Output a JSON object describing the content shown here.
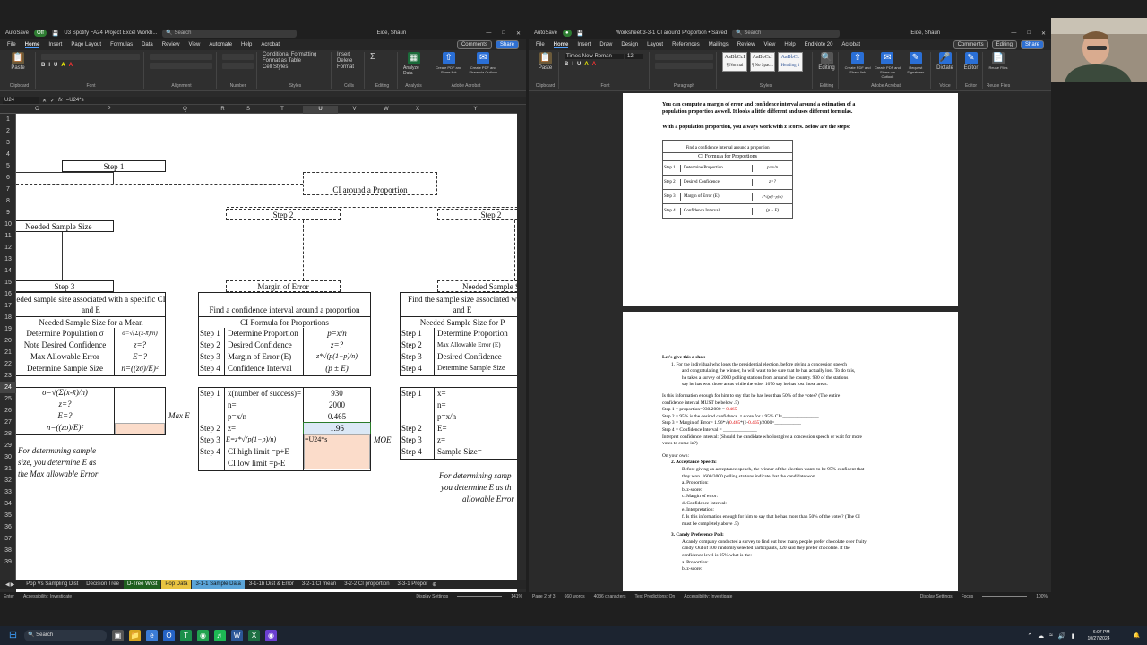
{
  "excel": {
    "autosave": "AutoSave",
    "toggle": "Off",
    "title": "U3 Spotify FA24 Project Excel Workb...",
    "search": "Search",
    "user": "Eide, Shaun",
    "menu": [
      "File",
      "Home",
      "Insert",
      "Page Layout",
      "Formulas",
      "Data",
      "Review",
      "View",
      "Automate",
      "Help",
      "Acrobat"
    ],
    "comments": "Comments",
    "share": "Share",
    "groups": [
      "Clipboard",
      "Font",
      "Alignment",
      "Number",
      "Styles",
      "Cells",
      "Editing",
      "Analysis",
      "Adobe Acrobat"
    ],
    "ribbon": {
      "paste": "Paste",
      "cond_format": "Conditional Formatting",
      "format_table": "Format as Table",
      "cell_styles": "Cell Styles",
      "insert": "Insert",
      "delete": "Delete",
      "format": "Format",
      "analyze": "Analyze Data",
      "pdf1": "Create PDF and Share link",
      "pdf2": "Create PDF and Share via Outlook"
    },
    "namebox": "U24",
    "formula": "=U24*s",
    "cols": [
      "O",
      "P",
      "Q",
      "R",
      "S",
      "T",
      "U",
      "V",
      "W",
      "X",
      "Y"
    ],
    "rows": [
      "1",
      "2",
      "3",
      "4",
      "5",
      "6",
      "7",
      "8",
      "9",
      "10",
      "11",
      "12",
      "13",
      "14",
      "15",
      "16",
      "17",
      "18",
      "19",
      "20",
      "21",
      "22",
      "23",
      "24",
      "25",
      "26",
      "27",
      "28",
      "29",
      "30",
      "31",
      "32",
      "33",
      "34",
      "35",
      "36",
      "37",
      "38",
      "39"
    ],
    "cells": {
      "step1": "Step 1",
      "ci_prop": "CI around a Proportion",
      "step2a": "Step 2",
      "step2b": "Step 2",
      "needed_size": "Needed Sample Size",
      "step3": "Step 3",
      "moe": "Margin of Error",
      "needed_size2": "Needed Sample S",
      "l_h13": "eded sample size associated with a specific CI",
      "l_h14": "and E",
      "l_h15": "Needed Sample Size for a Mean",
      "l16a": "Determine Population σ",
      "l16b": "σ=√(Σ(x-x̄)/n)",
      "l17a": "Note Desired Confidence",
      "l17b": "z=?",
      "l18a": "Max Allowable Error",
      "l18b": "E=?",
      "l19a": "Determine Sample Size",
      "l19b": "n=((zσ)/E)²",
      "l21": "σ=√(Σ(x-x̄)/n)",
      "l22": "z=?",
      "l23": "E=?",
      "l23r": "Max E",
      "l24": "n=((zσ)/E)²",
      "l26": "For determining sample",
      "l27": "size, you determine E as",
      "l28": "the Max allowable Error",
      "m_h13": "Find a confidence interval around a proportion",
      "m_h15": "CI Formula for Proportions",
      "m16a": "Step 1",
      "m16b": "Determine Proportion",
      "m16c": "p=x/n",
      "m17a": "Step 2",
      "m17b": "Desired Confidence",
      "m17c": "z=?",
      "m18a": "Step 3",
      "m18b": "Margin of Error (E)",
      "m18c": "z*√(p(1−p)/n)",
      "m19a": "Step 4",
      "m19b": "Confidence Interval",
      "m19c": "(p ± E)",
      "m21a": "Step 1",
      "m21b": "x(number of success)=",
      "m21c": "930",
      "m22b": "n=",
      "m22c": "2000",
      "m23b": "p=x/n",
      "m23c": "0.465",
      "m24a": "Step 2",
      "m24b": "z=",
      "m24c": "1.96",
      "m25a": "Step 3",
      "m25b": "E=z*√(p(1−p)/n)",
      "m25c": "=U24*s",
      "m25r": "MOE",
      "m26a": "Step 4",
      "m26b": "CI high limit =p+E",
      "m27b": "CI low limit =p-E",
      "r_h13": "Find the sample size associated w",
      "r_h14": "and E",
      "r_h15": "Needed Sample Size for P",
      "r16a": "Step 1",
      "r16b": "Determine Proportion",
      "r17a": "Step 2",
      "r17b": "Max Allowable Error (E)",
      "r18a": "Step 3",
      "r18b": "Desired Confidence",
      "r19a": "Step 4",
      "r19b": "Determine Sample Size",
      "r21a": "Step 1",
      "r21b": "x=",
      "r22b": "n=",
      "r23b": "p=x/n",
      "r24a": "Step 2",
      "r24b": "E=",
      "r25a": "Step 3",
      "r25b": "z=",
      "r26a": "Step 4",
      "r26b": "Sample Size=",
      "r27": "For determining samp",
      "r28": "you determine E as th",
      "r29": "allowable Error"
    },
    "tabs": [
      "Pop Vs Sampling Dist",
      "Decision Tree",
      "D-Tree Wkst",
      "Pop Data",
      "3-1-1 Sample Data",
      "3-1-1b Dist & Error",
      "3-2-1 CI mean",
      "3-2-2 CI proportion",
      "3-3-1 Propor"
    ],
    "status": [
      "Enter",
      "Accessibility: Investigate",
      "Display Settings",
      "141%"
    ]
  },
  "word": {
    "autosave": "AutoSave",
    "title": "Worksheet 3-3-1 CI around Proportion • Saved",
    "search": "Search",
    "user": "Eide, Shaun",
    "menu": [
      "File",
      "Home",
      "Insert",
      "Draw",
      "Design",
      "Layout",
      "References",
      "Mailings",
      "Review",
      "View",
      "Help",
      "EndNote 20",
      "Acrobat"
    ],
    "comments": "Comments",
    "editing": "Editing",
    "share": "Share",
    "font": "Times New Roman",
    "size": "12",
    "styles": [
      "AaBbCcI",
      "AaBbCcI",
      "AaBbCc"
    ],
    "style_names": [
      "¶ Normal",
      "¶ No Spac...",
      "Heading 1"
    ],
    "groups": [
      "Clipboard",
      "Font",
      "Paragraph",
      "Styles",
      "Editing",
      "Adobe Acrobat",
      "Voice",
      "Editor",
      "Reuse Files"
    ],
    "ribbon": {
      "paste": "Paste",
      "editing": "Editing",
      "pdf1": "Create PDF and Share link",
      "pdf2": "Create PDF and Share via Outlook",
      "sig": "Request Signatures",
      "dictate": "Dictate",
      "editor": "Editor",
      "reuse": "Reuse Files"
    },
    "p1_line1": "You can compute a margin of error and confidence interval around a estimation of a",
    "p1_line2": "population proportion as well. It looks a little different and uses different formulas.",
    "p1_line3": "With a population proportion, you always work with z scores. Below are the steps:",
    "tbl": {
      "title": "Find a confidence interval around a proportion",
      "sub": "CI Formula for Proportions",
      "rows": [
        [
          "Step 1",
          "Determine Proportion",
          "p=x/n"
        ],
        [
          "Step 2",
          "Desired Confidence",
          "z=?"
        ],
        [
          "Step 3",
          "Margin of Error (E)",
          "z*√(p(1−p)/n)"
        ],
        [
          "Step 4",
          "Confidence Interval",
          "(p ± E)"
        ]
      ]
    },
    "p2": {
      "h": "Let's give this a shot:",
      "q1": "1.   For the individual who loses the presidential election, before giving a concession speech",
      "q1b": "and congratulating the winner, he will want to be sure that he has actually lost. To do this,",
      "q1c": "he takes a survey of 2000 polling stations from around the country. 930 of the stations",
      "q1d": "say he has won those areas while the other 1070 say he has lost those areas.",
      "q2": "Is this information enough for him to say that he has less than 50% of the votes? (The entire",
      "q2b": "confidence interval MUST be below .5)",
      "s1a": "Step 1 = proportion=930/2000 = ",
      "s1b": "0.465",
      "s2": "Step 2 = 95% is the desired confidence. z score for a 95% CI=_______________",
      "s3a": "Step 3 = Margin of Error= 1.96*√(",
      "s3b": "0.465",
      "s3c": "*(1-",
      "s3d": "0.465",
      "s3e": ")/2000=___________",
      "s4": "Step 4 = Confidence Interval = ______________",
      "interp": "Interpret confidence interval: (Should the candidate who lost give a concession speech or wait for more",
      "interp2": "votes to come in?)",
      "own": "On your own:",
      "q3h": "2.   Acceptance Speech:",
      "q3a": "Before giving an acceptance speech, the winner of the election wants to be 95% confident that",
      "q3b": "they won. 1600/3000 polling stations indicate that the candidate won.",
      "li": [
        "a.   Proportion:",
        "b.   z-score:",
        "c.   Margin of error:",
        "d.   Confidence Interval:",
        "e.   Interpretation:",
        "f.   Is this information enough for him to say that he has more than 50% of the votes? (The CI",
        "      must be completely above .5)"
      ],
      "q4h": "3.   Candy Preference Poll:",
      "q4a": "A candy company conducted a survey to find out how many people prefer chocolate over fruity",
      "q4b": "candy. Out of 500 randomly selected participants, 320 said they prefer chocolate. If the",
      "q4c": "confidence level is 95% what is the:",
      "li2": [
        "a.   Proportion:",
        "b.   z-score:"
      ]
    },
    "status": [
      "Page 2 of 3",
      "660 words",
      "4036 characters",
      "Text Predictions: On",
      "Accessibility: Investigate",
      "Display Settings",
      "Focus",
      "100%"
    ]
  },
  "taskbar": {
    "search": "Search",
    "time": "6:07 PM",
    "date": "10/27/2024"
  }
}
